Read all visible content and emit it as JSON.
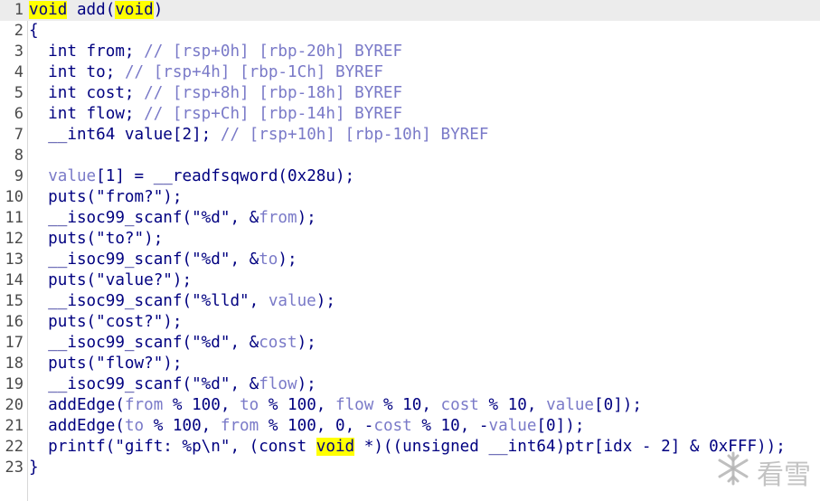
{
  "editor": {
    "line_numbers": [
      "1",
      "2",
      "3",
      "4",
      "5",
      "6",
      "7",
      "8",
      "9",
      "10",
      "11",
      "12",
      "13",
      "14",
      "15",
      "16",
      "17",
      "18",
      "19",
      "20",
      "21",
      "22",
      "23"
    ],
    "lines": [
      [
        {
          "t": "void",
          "c": "kw",
          "hl": true
        },
        {
          "t": " add(",
          "c": "txt"
        },
        {
          "t": "void",
          "c": "kw",
          "hl": true
        },
        {
          "t": ")",
          "c": "txt"
        }
      ],
      [
        {
          "t": "{",
          "c": "txt"
        }
      ],
      [
        {
          "t": "  int from; ",
          "c": "txt"
        },
        {
          "t": "// [rsp+0h] [rbp-20h] BYREF",
          "c": "com"
        }
      ],
      [
        {
          "t": "  int to; ",
          "c": "txt"
        },
        {
          "t": "// [rsp+4h] [rbp-1Ch] BYREF",
          "c": "com"
        }
      ],
      [
        {
          "t": "  int cost; ",
          "c": "txt"
        },
        {
          "t": "// [rsp+8h] [rbp-18h] BYREF",
          "c": "com"
        }
      ],
      [
        {
          "t": "  int flow; ",
          "c": "txt"
        },
        {
          "t": "// [rsp+Ch] [rbp-14h] BYREF",
          "c": "com"
        }
      ],
      [
        {
          "t": "  __int64 value[2]; ",
          "c": "txt"
        },
        {
          "t": "// [rsp+10h] [rbp-10h] BYREF",
          "c": "com"
        }
      ],
      [
        {
          "t": "",
          "c": "txt"
        }
      ],
      [
        {
          "t": "  ",
          "c": "txt"
        },
        {
          "t": "value",
          "c": "var"
        },
        {
          "t": "[1] = __readfsqword(0x28u);",
          "c": "txt"
        }
      ],
      [
        {
          "t": "  puts(\"from?\");",
          "c": "txt"
        }
      ],
      [
        {
          "t": "  __isoc99_scanf(\"%d\", &",
          "c": "txt"
        },
        {
          "t": "from",
          "c": "var"
        },
        {
          "t": ");",
          "c": "txt"
        }
      ],
      [
        {
          "t": "  puts(\"to?\");",
          "c": "txt"
        }
      ],
      [
        {
          "t": "  __isoc99_scanf(\"%d\", &",
          "c": "txt"
        },
        {
          "t": "to",
          "c": "var"
        },
        {
          "t": ");",
          "c": "txt"
        }
      ],
      [
        {
          "t": "  puts(\"value?\");",
          "c": "txt"
        }
      ],
      [
        {
          "t": "  __isoc99_scanf(\"%lld\", ",
          "c": "txt"
        },
        {
          "t": "value",
          "c": "var"
        },
        {
          "t": ");",
          "c": "txt"
        }
      ],
      [
        {
          "t": "  puts(\"cost?\");",
          "c": "txt"
        }
      ],
      [
        {
          "t": "  __isoc99_scanf(\"%d\", &",
          "c": "txt"
        },
        {
          "t": "cost",
          "c": "var"
        },
        {
          "t": ");",
          "c": "txt"
        }
      ],
      [
        {
          "t": "  puts(\"flow?\");",
          "c": "txt"
        }
      ],
      [
        {
          "t": "  __isoc99_scanf(\"%d\", &",
          "c": "txt"
        },
        {
          "t": "flow",
          "c": "var"
        },
        {
          "t": ");",
          "c": "txt"
        }
      ],
      [
        {
          "t": "  addEdge(",
          "c": "txt"
        },
        {
          "t": "from",
          "c": "var"
        },
        {
          "t": " % 100, ",
          "c": "txt"
        },
        {
          "t": "to",
          "c": "var"
        },
        {
          "t": " % 100, ",
          "c": "txt"
        },
        {
          "t": "flow",
          "c": "var"
        },
        {
          "t": " % 10, ",
          "c": "txt"
        },
        {
          "t": "cost",
          "c": "var"
        },
        {
          "t": " % 10, ",
          "c": "txt"
        },
        {
          "t": "value",
          "c": "var"
        },
        {
          "t": "[0]);",
          "c": "txt"
        }
      ],
      [
        {
          "t": "  addEdge(",
          "c": "txt"
        },
        {
          "t": "to",
          "c": "var"
        },
        {
          "t": " % 100, ",
          "c": "txt"
        },
        {
          "t": "from",
          "c": "var"
        },
        {
          "t": " % 100, 0, -",
          "c": "txt"
        },
        {
          "t": "cost",
          "c": "var"
        },
        {
          "t": " % 10, -",
          "c": "txt"
        },
        {
          "t": "value",
          "c": "var"
        },
        {
          "t": "[0]);",
          "c": "txt"
        }
      ],
      [
        {
          "t": "  printf(\"gift: %p\\n\", (const ",
          "c": "txt"
        },
        {
          "t": "void",
          "c": "kw",
          "hl": true
        },
        {
          "t": " *)((unsigned __int64)ptr[idx - 2] & 0xFFF));",
          "c": "txt"
        }
      ],
      [
        {
          "t": "}",
          "c": "txt"
        }
      ]
    ]
  },
  "watermark": {
    "icon": "snowflake-icon",
    "text": "看雪"
  }
}
